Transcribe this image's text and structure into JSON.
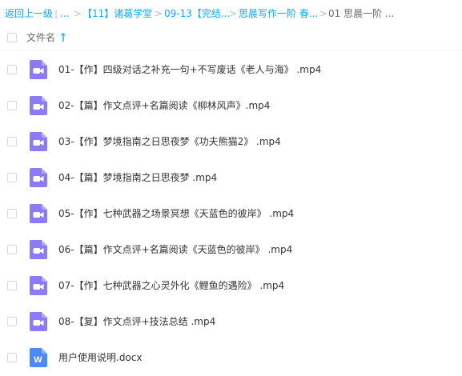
{
  "breadcrumb": {
    "back": "返回上一级",
    "sep": "|",
    "ellipsis": "...",
    "arrow": ">",
    "item1": "【11】诸葛学堂",
    "item2": "09-13【完结...",
    "item3": "思晨写作一阶 春...",
    "current": "01 思晨一阶 ..."
  },
  "list_header": {
    "column_name": "文件名"
  },
  "colors": {
    "link": "#09aaff",
    "video_icon": "#8b7cf6",
    "doc_icon": "#4b8bf7"
  },
  "files": [
    {
      "name": "01-【作】四级对话之补充一句+不写废话《老人与海》 .mp4",
      "icon": "video-icon"
    },
    {
      "name": "02-【篇】作文点评+名篇阅读《柳林风声》.mp4",
      "icon": "video-icon"
    },
    {
      "name": "03-【作】梦境指南之日思夜梦《功夫熊猫2》 .mp4",
      "icon": "video-icon"
    },
    {
      "name": "04-【篇】梦境指南之日思夜梦 .mp4",
      "icon": "video-icon"
    },
    {
      "name": "05-【作】七种武器之场景冥想《天蓝色的彼岸》 .mp4",
      "icon": "video-icon"
    },
    {
      "name": "06-【篇】作文点评+名篇阅读《天蓝色的彼岸》 .mp4",
      "icon": "video-icon"
    },
    {
      "name": "07-【作】七种武器之心灵外化《鲤鱼的遇险》 .mp4",
      "icon": "video-icon"
    },
    {
      "name": "08-【复】作文点评+技法总结 .mp4",
      "icon": "video-icon"
    },
    {
      "name": "用户使用说明.docx",
      "icon": "word-doc-icon",
      "badge": "W"
    }
  ]
}
